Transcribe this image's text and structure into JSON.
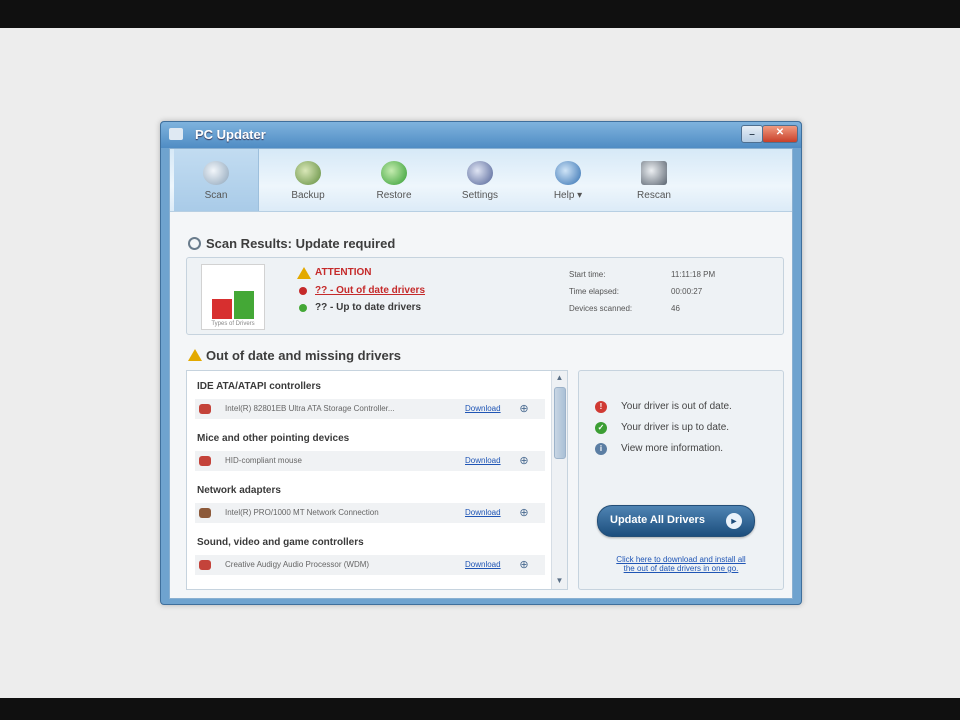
{
  "window": {
    "title": "PC Updater"
  },
  "toolbar": {
    "items": [
      {
        "label": "Scan"
      },
      {
        "label": "Backup"
      },
      {
        "label": "Restore"
      },
      {
        "label": "Settings"
      },
      {
        "label": "Help ▾"
      },
      {
        "label": "Rescan"
      }
    ]
  },
  "scan_results": {
    "title": "Scan Results: Update required",
    "chart_caption": "Types of Drivers",
    "attention": "ATTENTION",
    "out_of_date_line": "?? - Out of date drivers",
    "up_to_date_line": "?? - Up to date drivers",
    "stats": [
      {
        "label": "Start time:",
        "value": "11:11:18 PM"
      },
      {
        "label": "Time elapsed:",
        "value": "00:00:27"
      },
      {
        "label": "Devices scanned:",
        "value": "46"
      }
    ]
  },
  "drivers_section": {
    "title": "Out of date and missing drivers",
    "categories": [
      {
        "name": "IDE ATA/ATAPI controllers",
        "device": "Intel(R) 82801EB Ultra ATA Storage Controller...",
        "link": "Download"
      },
      {
        "name": "Mice and other pointing devices",
        "device": "HID-compliant mouse",
        "link": "Download"
      },
      {
        "name": "Network adapters",
        "device": "Intel(R) PRO/1000 MT Network Connection",
        "link": "Download"
      },
      {
        "name": "Sound, video and game controllers",
        "device": "Creative Audigy Audio Processor (WDM)",
        "link": "Download"
      }
    ]
  },
  "legend": {
    "out_of_date": "Your driver is out of date.",
    "up_to_date": "Your driver is up to date.",
    "more_info": "View more information."
  },
  "actions": {
    "update_all": "Update All Drivers",
    "download_all_line1": "Click here to download and install all",
    "download_all_line2": "the out of date drivers in one go."
  },
  "colors": {
    "accent": "#1c4e7d",
    "warning": "#d72f2f",
    "ok": "#44a836",
    "link": "#1f55b5"
  }
}
